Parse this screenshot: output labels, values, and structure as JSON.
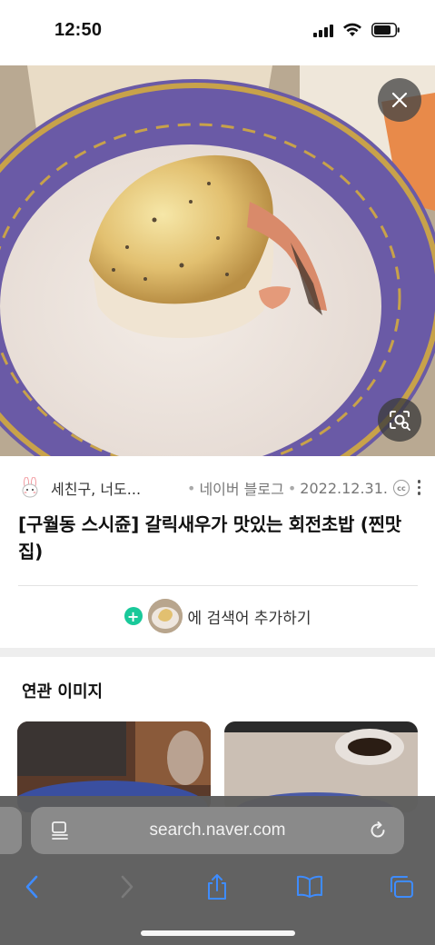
{
  "status_bar": {
    "time": "12:50"
  },
  "hero": {
    "close_icon": "close-icon",
    "lens_icon": "image-search-icon"
  },
  "result": {
    "author": "세친구, 너도...",
    "source": "네이버 블로그",
    "date": "2022.12.31.",
    "license_badge": "cc",
    "title": "[구월동 스시쥰] 갈릭새우가 맛있는 회전초밥 (찐맛집)"
  },
  "add_search": {
    "label": "에 검색어 추가하기",
    "plus": "+"
  },
  "related": {
    "title": "연관 이미지"
  },
  "browser": {
    "url": "search.naver.com",
    "icons": [
      "back-icon",
      "forward-icon",
      "share-icon",
      "bookmarks-icon",
      "tabs-icon"
    ]
  },
  "colors": {
    "accent_green": "#19c99a",
    "safari_blue": "#3e8cff",
    "bar_bg": "#5c5c5c"
  }
}
